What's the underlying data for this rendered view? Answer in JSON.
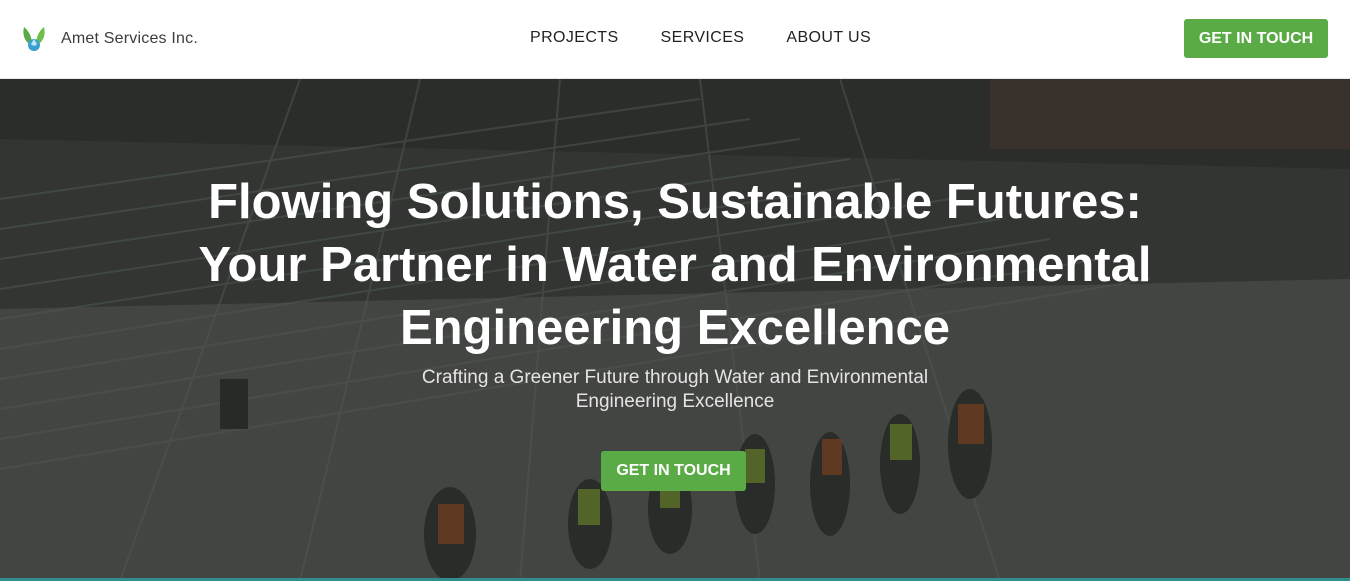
{
  "brand": {
    "name": "Amet Services Inc.",
    "logo_icon": "leaf-drop-logo-icon"
  },
  "nav": {
    "items": [
      "PROJECTS",
      "SERVICES",
      "ABOUT US"
    ]
  },
  "header": {
    "cta_label": "GET IN TOUCH"
  },
  "hero": {
    "title_lines": [
      "Flowing Solutions, Sustainable Futures:",
      "Your Partner in Water and Environmental",
      "Engineering Excellence"
    ],
    "subtitle_lines": [
      "Crafting a Greener Future through Water and Environmental",
      "Engineering Excellence"
    ],
    "cta_label": "GET IN TOUCH",
    "background_image": "construction-site-workers-photo"
  },
  "colors": {
    "accent": "#5aab45",
    "header_bg": "#ffffff",
    "hero_text": "#ffffff"
  }
}
